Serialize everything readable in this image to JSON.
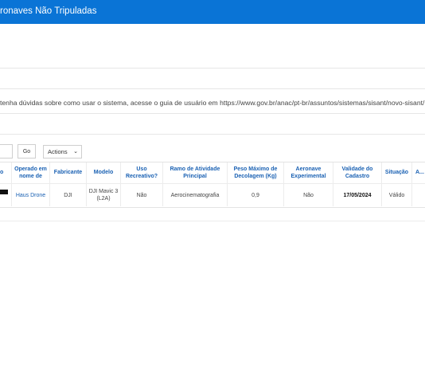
{
  "header": {
    "title": "ronaves Não Tripuladas"
  },
  "info_text": "tenha dúvidas sobre como usar o sistema, acesse o guia de usuário em https://www.gov.br/anac/pt-br/assuntos/sistemas/sisant/novo-sisant/",
  "toolbar": {
    "go_icon": "Go",
    "actions_label": "Actions",
    "actions_icon": "chevron-down-icon"
  },
  "table": {
    "headers": [
      "o",
      "Operado em nome de",
      "Fabricante",
      "Modelo",
      "Uso Recreativo?",
      "Ramo de Atividade Principal",
      "Peso Máximo de Decolagem (Kg)",
      "Aeronave Experimental",
      "Validade do Cadastro",
      "Situação",
      "A... Av..."
    ],
    "row": {
      "operado": "Haus Drone",
      "fabricante": "DJI",
      "modelo": "DJI Mavic 3 (L2A)",
      "uso": "Não",
      "ramo": "Aerocinematografia",
      "peso": "0,9",
      "experimental": "Não",
      "validade": "17/05/2024",
      "situacao": "Válido"
    }
  },
  "colors": {
    "header_bg": "#0a74d6",
    "link": "#1a61b3"
  }
}
